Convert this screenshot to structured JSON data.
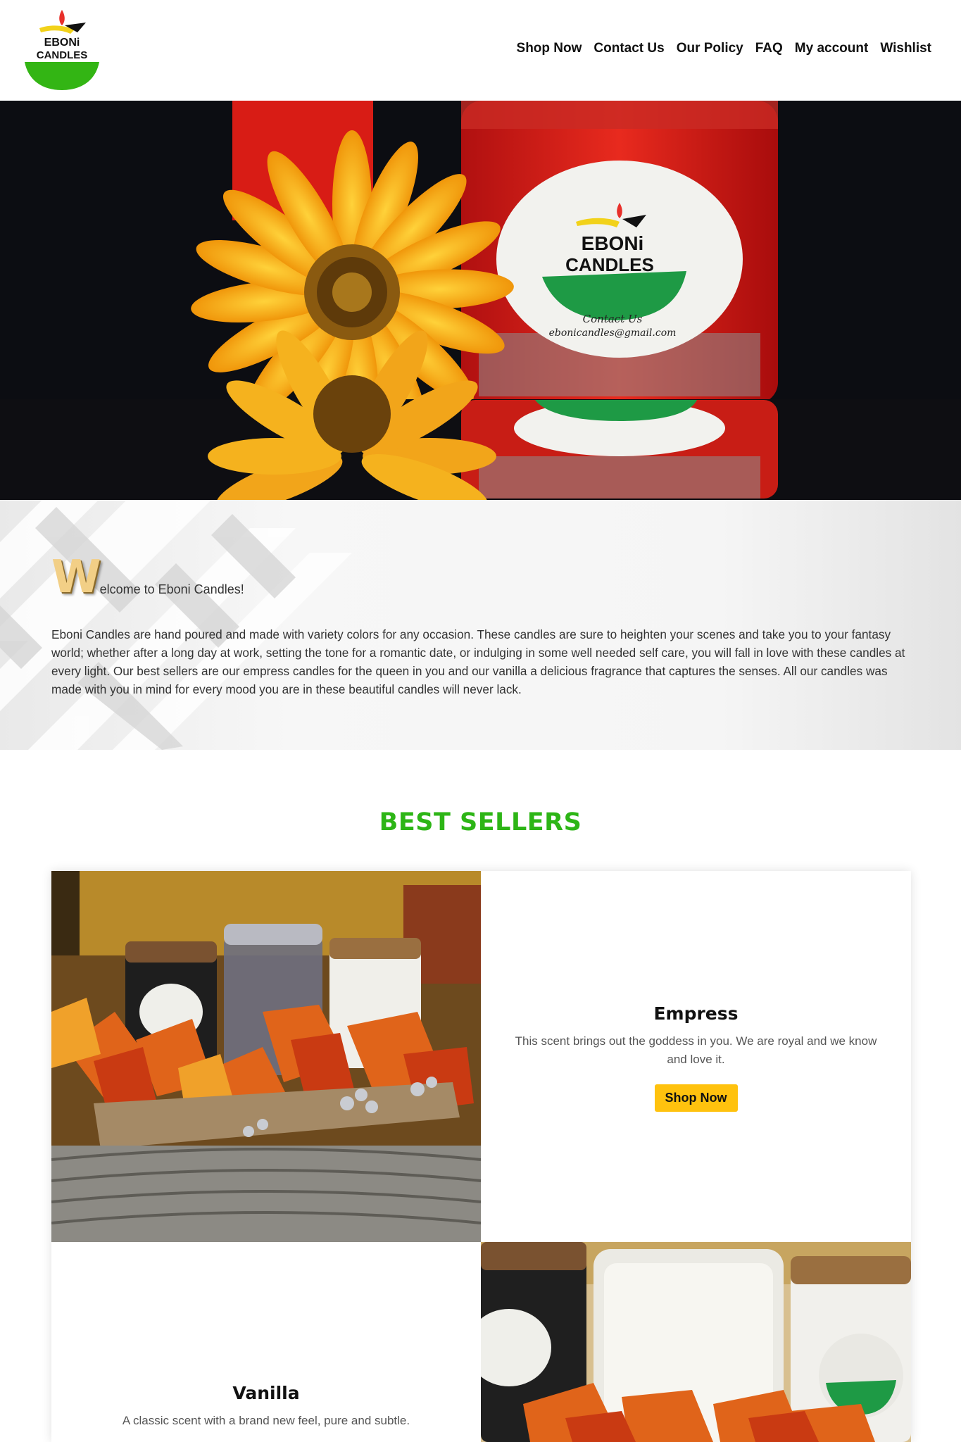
{
  "brand": {
    "logo_line1": "EBONi",
    "logo_line2": "CANDLES"
  },
  "nav": {
    "items": [
      {
        "label": "Shop Now"
      },
      {
        "label": "Contact Us"
      },
      {
        "label": "Our Policy"
      },
      {
        "label": "FAQ"
      },
      {
        "label": "My account"
      },
      {
        "label": "Wishlist"
      }
    ]
  },
  "hero": {
    "label_line1": "EBONi",
    "label_line2": "CANDLES",
    "label_contact": "Contact Us",
    "label_email": "ebonicandles@gmail.com"
  },
  "welcome": {
    "drop_cap": "W",
    "title_rest": "elcome to Eboni Candles!",
    "body": "Eboni Candles are hand poured and made with variety colors for any occasion. These candles are sure to heighten your scenes and take you to your fantasy world; whether after a long day at work, setting the tone for a romantic date, or indulging in some well needed self care, you will fall in love with these candles at every light. Our best sellers are our empress candles for the queen in you and our vanilla a delicious fragrance that captures the senses. All our candles was made with you in mind for every mood you are in these beautiful candles will never lack."
  },
  "best_sellers": {
    "heading": "BEST SELLERS",
    "products": [
      {
        "name": "Empress",
        "description": "This scent brings out the goddess in you. We are royal and we know and love it.",
        "button": "Shop Now"
      },
      {
        "name": "Vanilla",
        "description": "A classic scent with a brand new feel, pure and subtle."
      }
    ]
  },
  "colors": {
    "accent_green": "#2db516",
    "button_yellow": "#ffc20e",
    "logo_red": "#e8302a",
    "logo_yellow": "#f2d21a"
  }
}
